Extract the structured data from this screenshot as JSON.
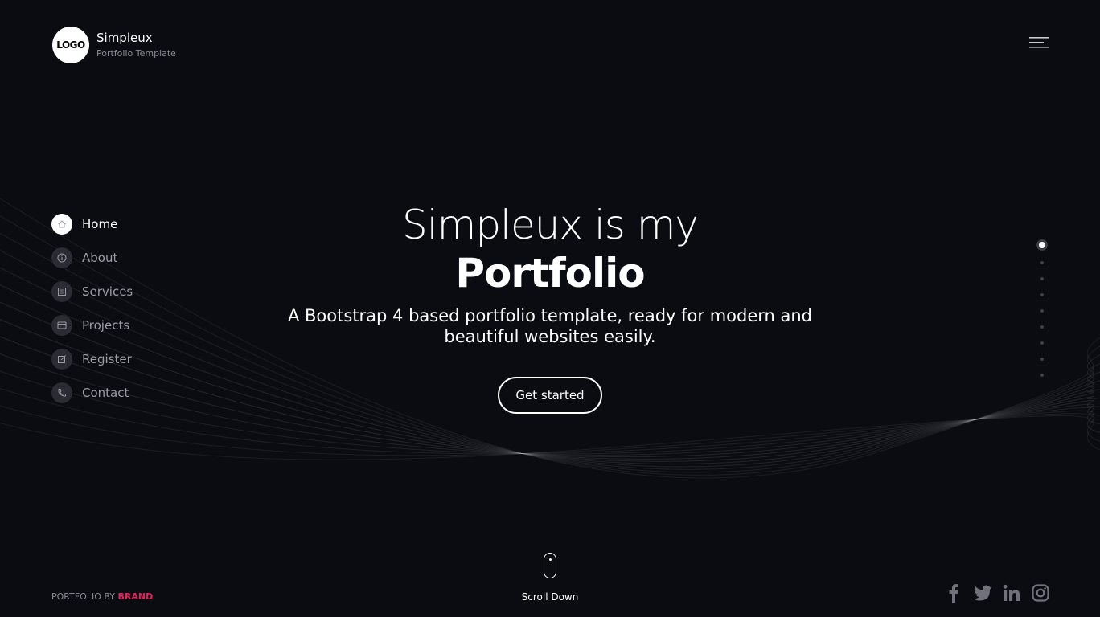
{
  "header": {
    "logo_text": "LOGO",
    "brand_name": "Simpleux",
    "brand_tagline": "Portfolio Template",
    "menu_icon": "hamburger-menu-icon"
  },
  "sidebar": {
    "items": [
      {
        "label": "Home",
        "icon": "home-icon",
        "active": true
      },
      {
        "label": "About",
        "icon": "info-icon",
        "active": false
      },
      {
        "label": "Services",
        "icon": "list-icon",
        "active": false
      },
      {
        "label": "Projects",
        "icon": "window-icon",
        "active": false
      },
      {
        "label": "Register",
        "icon": "edit-icon",
        "active": false
      },
      {
        "label": "Contact",
        "icon": "phone-icon",
        "active": false
      }
    ]
  },
  "hero": {
    "title_line1": "Simpleux is my",
    "title_line2": "Portfolio",
    "subtitle": "A Bootstrap 4 based portfolio template, ready for modern and beautiful websites easily.",
    "cta_label": "Get started"
  },
  "section_dots": {
    "count": 9,
    "active_index": 0
  },
  "scroll": {
    "label": "Scroll Down",
    "icon": "mouse-icon"
  },
  "footer": {
    "credit_prefix": "PORTFOLIO BY",
    "credit_brand": "BRAND",
    "social": [
      "facebook-icon",
      "twitter-icon",
      "linkedin-icon",
      "instagram-icon"
    ]
  },
  "colors": {
    "background": "#0b0c12",
    "accent": "#e0245e",
    "text": "#ffffff",
    "muted": "#9a9ca6"
  }
}
